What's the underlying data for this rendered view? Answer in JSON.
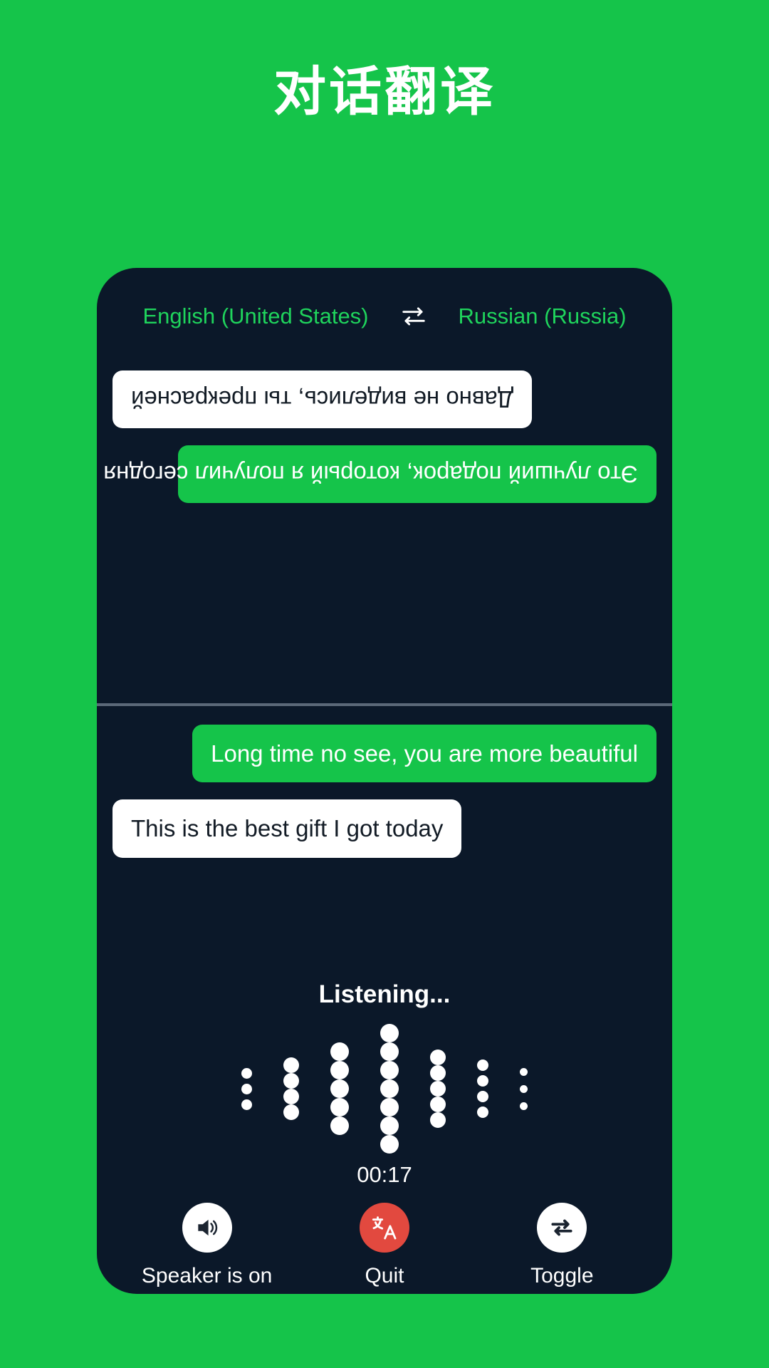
{
  "page": {
    "title": "对话翻译",
    "background_color": "#15c44a",
    "panel_color": "#0b1829"
  },
  "language_bar": {
    "source_language": "English (United States)",
    "target_language": "Russian (Russia)",
    "swap_icon": "swap-horizontal-icon",
    "text_color": "#1fd45c"
  },
  "conversation": {
    "top_messages": [
      {
        "text": "Это лучший подарок, который я получил сегодня",
        "style": "green",
        "align": "left"
      },
      {
        "text": "Давно не виделись, ты прекрасней",
        "style": "white",
        "align": "right"
      }
    ],
    "bottom_messages": [
      {
        "text": "Long time no see, you are more beautiful",
        "style": "green",
        "align": "right"
      },
      {
        "text": "This is the best gift I got today",
        "style": "white",
        "align": "left"
      }
    ]
  },
  "status": {
    "listening_label": "Listening...",
    "timer": "00:17"
  },
  "waveform": {
    "columns": [
      {
        "dots": 3,
        "size": 15,
        "gap": 22
      },
      {
        "dots": 4,
        "size": 22,
        "gap": 22
      },
      {
        "dots": 5,
        "size": 26,
        "gap": 22
      },
      {
        "dots": 7,
        "size": 26,
        "gap": 20
      },
      {
        "dots": 5,
        "size": 22,
        "gap": 22
      },
      {
        "dots": 4,
        "size": 16,
        "gap": 22
      },
      {
        "dots": 3,
        "size": 11,
        "gap": 24
      }
    ],
    "color": "#ffffff"
  },
  "controls": [
    {
      "label": "Speaker is on",
      "icon": "speaker-on-icon",
      "circle_color": "#ffffff",
      "icon_color": "#1b2430"
    },
    {
      "label": "Quit",
      "icon": "translate-icon",
      "circle_color": "#e2493f",
      "icon_color": "#ffffff"
    },
    {
      "label": "Toggle",
      "icon": "swap-repeat-icon",
      "circle_color": "#ffffff",
      "icon_color": "#1b2430"
    }
  ]
}
